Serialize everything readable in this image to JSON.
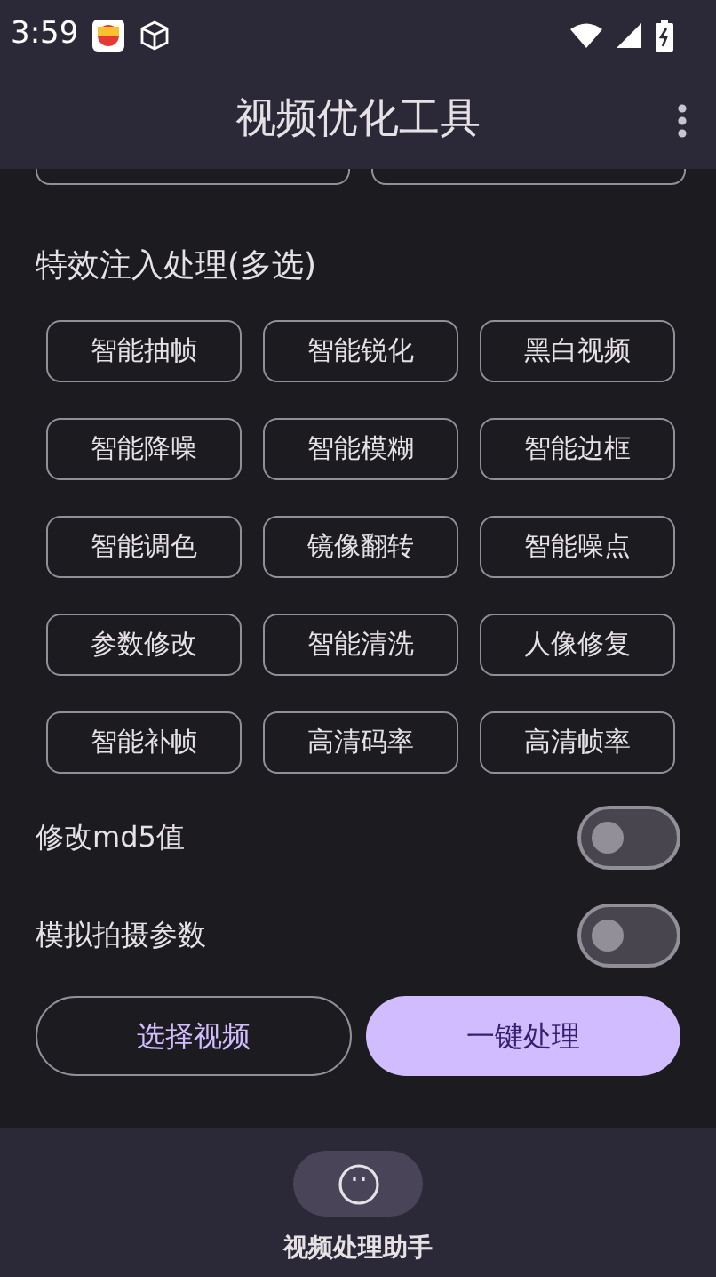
{
  "status_bar": {
    "time": "3:59"
  },
  "app_bar": {
    "title": "视频优化工具"
  },
  "effects": {
    "title": "特效注入处理(多选)",
    "options": [
      {
        "label": "智能抽帧",
        "selected": false
      },
      {
        "label": "智能锐化",
        "selected": false
      },
      {
        "label": "黑白视频",
        "selected": false
      },
      {
        "label": "智能降噪",
        "selected": false
      },
      {
        "label": "智能模糊",
        "selected": false
      },
      {
        "label": "智能边框",
        "selected": false
      },
      {
        "label": "智能调色",
        "selected": false
      },
      {
        "label": "镜像翻转",
        "selected": false
      },
      {
        "label": "智能噪点",
        "selected": false
      },
      {
        "label": "参数修改",
        "selected": false
      },
      {
        "label": "智能清洗",
        "selected": false
      },
      {
        "label": "人像修复",
        "selected": false
      },
      {
        "label": "智能补帧",
        "selected": false
      },
      {
        "label": "高清码率",
        "selected": false
      },
      {
        "label": "高清帧率",
        "selected": false
      }
    ]
  },
  "switches": [
    {
      "label": "修改md5值",
      "on": false
    },
    {
      "label": "模拟拍摄参数",
      "on": false
    }
  ],
  "buttons": [
    {
      "label": "选择视频",
      "kind": "outlined"
    },
    {
      "label": "一键处理",
      "kind": "filled"
    }
  ],
  "bottom_nav": [
    {
      "label": "视频处理助手",
      "selected": true
    }
  ]
}
